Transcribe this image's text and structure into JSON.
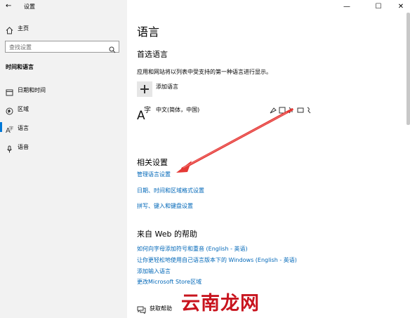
{
  "window": {
    "title": "设置"
  },
  "sidebar": {
    "home": "主页",
    "search_placeholder": "查找设置",
    "section": "时间和语言",
    "items": [
      {
        "label": "日期和时间",
        "icon": "calendar-icon"
      },
      {
        "label": "区域",
        "icon": "globe-icon"
      },
      {
        "label": "语言",
        "icon": "language-icon",
        "selected": true
      },
      {
        "label": "语音",
        "icon": "microphone-icon"
      }
    ]
  },
  "main": {
    "title": "语言",
    "preferred_heading": "首选语言",
    "preferred_desc": "应用和网站将以列表中受支持的第一种语言进行显示。",
    "add_language": "添加语言",
    "language_item": "中文(简体，中国)",
    "related_heading": "相关设置",
    "related_links": [
      "管理语言设置",
      "日期、时间和区域格式设置",
      "拼写、键入和键盘设置"
    ],
    "help_heading": "来自 Web 的帮助",
    "help_links": [
      "如何向字母添加符号和重音 (English - 英语)",
      "让你更轻松地使用自己语言版本下的 Windows (English - 英语)",
      "添加输入语言",
      "更改Microsoft Store区域"
    ],
    "get_help": "获取帮助"
  },
  "watermark": "云南龙网",
  "colors": {
    "accent": "#0078d7",
    "link": "#0067b8",
    "arrow": "#e53935",
    "watermark": "#c8141e"
  }
}
